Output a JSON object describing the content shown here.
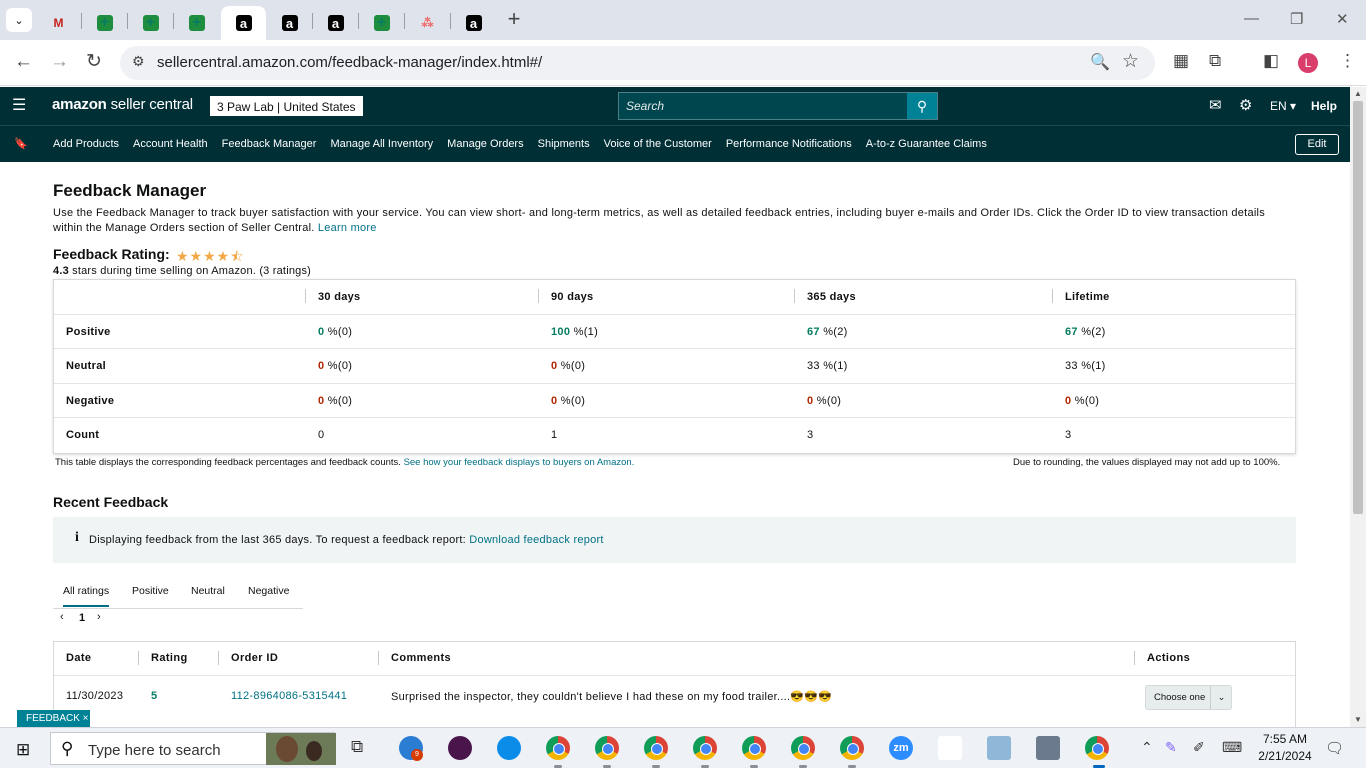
{
  "browser": {
    "url": "sellercentral.amazon.com/feedback-manager/index.html#/",
    "tabs": [
      {
        "icon": "gmail-icon",
        "glyph": "M",
        "kind": "m",
        "active": false
      },
      {
        "icon": "sheets-icon",
        "glyph": "+",
        "kind": "g",
        "active": false
      },
      {
        "icon": "sheets-icon",
        "glyph": "+",
        "kind": "g",
        "active": false
      },
      {
        "icon": "sheets-icon",
        "glyph": "+",
        "kind": "g",
        "active": false
      },
      {
        "icon": "amazon-icon",
        "glyph": "a",
        "kind": "a",
        "active": true
      },
      {
        "icon": "amazon-icon",
        "glyph": "a",
        "kind": "a",
        "active": false
      },
      {
        "icon": "amazon-icon",
        "glyph": "a",
        "kind": "a",
        "active": false
      },
      {
        "icon": "sheets-icon",
        "glyph": "+",
        "kind": "g",
        "active": false
      },
      {
        "icon": "asana-icon",
        "glyph": "⁂",
        "kind": "as",
        "active": false
      },
      {
        "icon": "amazon-icon",
        "glyph": "a",
        "kind": "a",
        "active": false
      }
    ],
    "profile_initial": "L"
  },
  "header": {
    "logo_bold": "amazon",
    "logo_rest": " seller central",
    "store": "3 Paw Lab | United States",
    "search_placeholder": "Search",
    "language": "EN ▾",
    "help": "Help"
  },
  "nav": {
    "items": [
      "Add Products",
      "Account Health",
      "Feedback Manager",
      "Manage All Inventory",
      "Manage Orders",
      "Shipments",
      "Voice of the Customer",
      "Performance Notifications",
      "A-to-z Guarantee Claims"
    ],
    "edit": "Edit"
  },
  "page": {
    "title": "Feedback Manager",
    "intro": "Use the Feedback Manager to track buyer satisfaction with your service. You can view short- and long-term metrics, as well as detailed feedback entries, including buyer e-mails and Order IDs. Click the Order ID to view transaction details within the Manage Orders section of Seller Central.",
    "learn_more": "Learn more",
    "rating_label": "Feedback Rating:",
    "stars": "★★★★⯪",
    "rating_value": "4.3",
    "rating_text": " stars during time selling on Amazon. (3 ratings)"
  },
  "feedback_table": {
    "headers": [
      "30 days",
      "90 days",
      "365 days",
      "Lifetime"
    ],
    "rows": [
      {
        "label": "Positive",
        "color": "g",
        "cells": [
          [
            "0",
            " %(0)"
          ],
          [
            "100",
            " %(1)"
          ],
          [
            "67",
            " %(2)"
          ],
          [
            "67",
            " %(2)"
          ]
        ]
      },
      {
        "label": "Neutral",
        "color": "mixed",
        "cells": [
          [
            "0",
            " %(0)"
          ],
          [
            "0",
            " %(0)"
          ],
          [
            "33",
            " %(1)"
          ],
          [
            "33",
            " %(1)"
          ]
        ]
      },
      {
        "label": "Negative",
        "color": "r",
        "cells": [
          [
            "0",
            " %(0)"
          ],
          [
            "0",
            " %(0)"
          ],
          [
            "0",
            " %(0)"
          ],
          [
            "0",
            " %(0)"
          ]
        ]
      },
      {
        "label": "Count",
        "color": "none",
        "cells": [
          [
            "0",
            ""
          ],
          [
            "1",
            ""
          ],
          [
            "3",
            ""
          ],
          [
            "3",
            ""
          ]
        ]
      }
    ],
    "note_left": "This table displays the corresponding feedback percentages and feedback counts.",
    "note_link": "See how your feedback displays to buyers on Amazon.",
    "note_right": "Due to rounding, the values displayed may not add up to 100%."
  },
  "recent": {
    "title": "Recent Feedback",
    "info": "Displaying feedback from the last 365 days. To request a feedback report: ",
    "info_link": "Download feedback report",
    "tabs": [
      "All ratings",
      "Positive",
      "Neutral",
      "Negative"
    ],
    "page": "1",
    "columns": [
      "Date",
      "Rating",
      "Order ID",
      "Comments",
      "Actions"
    ],
    "rows": [
      {
        "date": "11/30/2023",
        "rating": "5",
        "order_id": "112-8964086-5315441",
        "comment": "Surprised the inspector, they couldn't believe I had these on my food trailer....😎😎😎",
        "action": "Choose one"
      }
    ]
  },
  "feedback_tag": "FEEDBACK ×",
  "taskbar": {
    "search_placeholder": "Type here to search",
    "time": "7:55 AM",
    "date": "2/21/2024"
  }
}
